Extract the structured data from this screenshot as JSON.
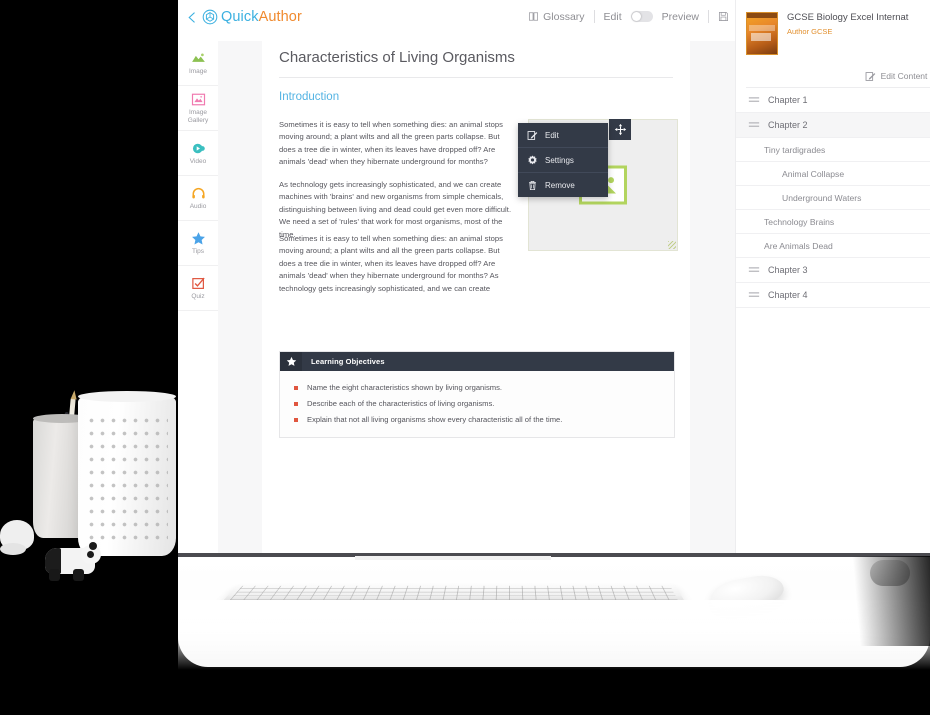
{
  "app": {
    "logo_back_icon": "chevron-left-icon",
    "logo_mark_icon": "hexagon-logo-icon",
    "logo_first": "Quick",
    "logo_second": "Author"
  },
  "toolbar": {
    "glossary_icon": "book-icon",
    "glossary_label": "Glossary",
    "edit_label": "Edit",
    "toggle_state": "off",
    "preview_label": "Preview",
    "save_icon": "floppy-save-icon"
  },
  "toolrail": {
    "items": [
      {
        "label": "Image",
        "icon": "image-icon",
        "color": "#8cc152"
      },
      {
        "label": "Image Gallery",
        "icon": "image-gallery-icon",
        "color": "#f07ab0"
      },
      {
        "label": "Video",
        "icon": "video-icon",
        "color": "#3bbfc0"
      },
      {
        "label": "Audio",
        "icon": "audio-headphones-icon",
        "color": "#f5a623"
      },
      {
        "label": "Tips",
        "icon": "star-icon",
        "color": "#4aa3e8"
      },
      {
        "label": "Quiz",
        "icon": "quiz-checkbox-icon",
        "color": "#e0563f"
      }
    ]
  },
  "page": {
    "title": "Characteristics of Living Organisms",
    "section_heading": "Introduction",
    "paragraphs": [
      "Sometimes it is easy to tell when something dies: an animal stops moving around; a plant wilts and all the green parts collapse. But does a tree die in winter, when its leaves have dropped off? Are animals 'dead' when they hibernate underground for months?",
      "As technology gets increasingly sophisticated, and we can create machines with 'brains' and new organisms from simple chemicals, distinguishing\nbetween living and dead could get even more difficult. We need a set of 'rules' that work for most organisms, most of the time.",
      "Sometimes it is easy to tell when something dies: an animal stops moving around; a plant wilts and all the green parts collapse. But does a tree die in winter, when its leaves have dropped off? Are animals 'dead' when they hibernate underground for months? As technology gets increasingly sophisticated, and we can create"
    ]
  },
  "image_block": {
    "placeholder_icon": "image-placeholder-icon",
    "move_handle_icon": "move-arrows-icon",
    "resize_handle_icon": "resize-corner-icon"
  },
  "context_menu": {
    "items": [
      {
        "label": "Edit",
        "icon": "pencil-square-icon"
      },
      {
        "label": "Settings",
        "icon": "gear-icon"
      },
      {
        "label": "Remove",
        "icon": "trash-icon"
      }
    ]
  },
  "learning_objectives": {
    "star_icon": "star-icon",
    "title": "Learning Objectives",
    "items": [
      "Name the eight characteristics shown by living organisms.",
      "Describe each of the characteristics of living organisms.",
      "Explain that not all living organisms show every characteristic all of the time."
    ]
  },
  "book_panel": {
    "cover_icon": "book-cover-thumbnail",
    "title": "GCSE Biology Excel Internat",
    "author": "Author GCSE",
    "edit_content_icon": "pencil-square-icon",
    "edit_content_label": "Edit Content",
    "tree": [
      {
        "label": "Chapter 1",
        "level": "chapter",
        "active": false,
        "icon": "drag-handle-icon"
      },
      {
        "label": "Chapter 2",
        "level": "chapter",
        "active": true,
        "icon": "drag-handle-icon"
      },
      {
        "label": "Tiny tardigrades",
        "level": "sub1",
        "active": false
      },
      {
        "label": "Animal Collapse",
        "level": "sub2",
        "active": false
      },
      {
        "label": "Underground Waters",
        "level": "sub2",
        "active": false
      },
      {
        "label": "Technology Brains",
        "level": "sub1",
        "active": false
      },
      {
        "label": "Are Animals Dead",
        "level": "sub1",
        "active": false
      },
      {
        "label": "Chapter 3",
        "level": "chapter",
        "active": false,
        "icon": "drag-handle-icon"
      },
      {
        "label": "Chapter 4",
        "level": "chapter",
        "active": false,
        "icon": "drag-handle-icon"
      }
    ]
  },
  "scene": {
    "keyboard": "desktop-keyboard",
    "mouse": "desktop-mouse",
    "pen_cup": "concrete-pen-cup",
    "vase": "white-perforated-vase",
    "figurine": "panda-figurine"
  },
  "colors": {
    "brand_blue": "#3bb0e0",
    "brand_orange": "#f08a2e",
    "accent_red": "#e0563f",
    "dark_panel": "#333a47",
    "heading_blue": "#53b3e3"
  }
}
